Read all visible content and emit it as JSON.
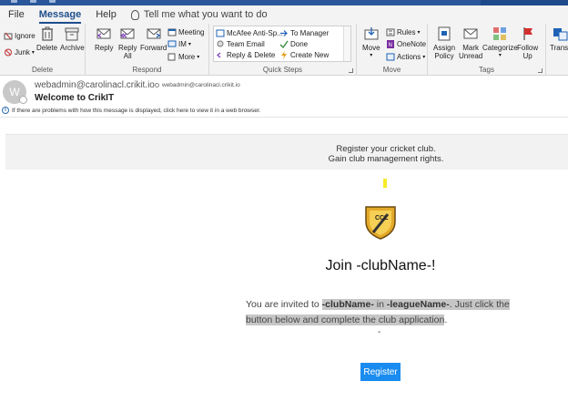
{
  "menu": {
    "items": [
      "File",
      "Message",
      "Help"
    ],
    "active": "Message",
    "tell_me": "Tell me what you want to do"
  },
  "ribbon": {
    "delete_group": {
      "label": "Delete",
      "ignore": "Ignore",
      "junk": "Junk",
      "delete": "Delete",
      "archive": "Archive"
    },
    "respond_group": {
      "label": "Respond",
      "reply": "Reply",
      "reply_all_1": "Reply",
      "reply_all_2": "All",
      "forward": "Forward",
      "meeting": "Meeting",
      "im": "IM",
      "more": "More"
    },
    "quick_steps": {
      "label": "Quick Steps",
      "items": [
        "McAfee Anti-Sp...",
        "Team Email",
        "Reply & Delete",
        "To Manager",
        "Done",
        "Create New"
      ]
    },
    "move_group": {
      "label": "Move",
      "move": "Move",
      "rules": "Rules",
      "onenote": "OneNote",
      "actions": "Actions"
    },
    "tags_group": {
      "label": "Tags",
      "assign_policy_1": "Assign",
      "assign_policy_2": "Policy",
      "mark_unread_1": "Mark",
      "mark_unread_2": "Unread",
      "categorize": "Categorize",
      "follow_up_1": "Follow",
      "follow_up_2": "Up",
      "translate": "Transl"
    }
  },
  "message": {
    "avatar_initial": "W",
    "sender": "webadmin@carolinacl.crikit.io",
    "to": "webadmin@carolinacl.crikit.io",
    "subject": "Welcome to CrikIT",
    "info_bar": "If there are problems with how this message is displayed, click here to view it in a web browser."
  },
  "email_body": {
    "banner_line1": "Register your cricket club.",
    "banner_line2": "Gain club management rights.",
    "logo_text": "CCL",
    "heading": "Join -clubName-!",
    "invite_prefix": "You are invited to ",
    "club_name": "-clubName-",
    "in_word": " in ",
    "league_name": "-leagueName-",
    "invite_suffix": ". Just click the button below and complete the club application",
    "period": ".",
    "dash": "-",
    "register_label": "Register"
  },
  "colors": {
    "accent": "#2b579a",
    "register_button": "#1a8cf0",
    "banner_bg": "#f2f2f2",
    "highlight": "#c6c6c6"
  }
}
